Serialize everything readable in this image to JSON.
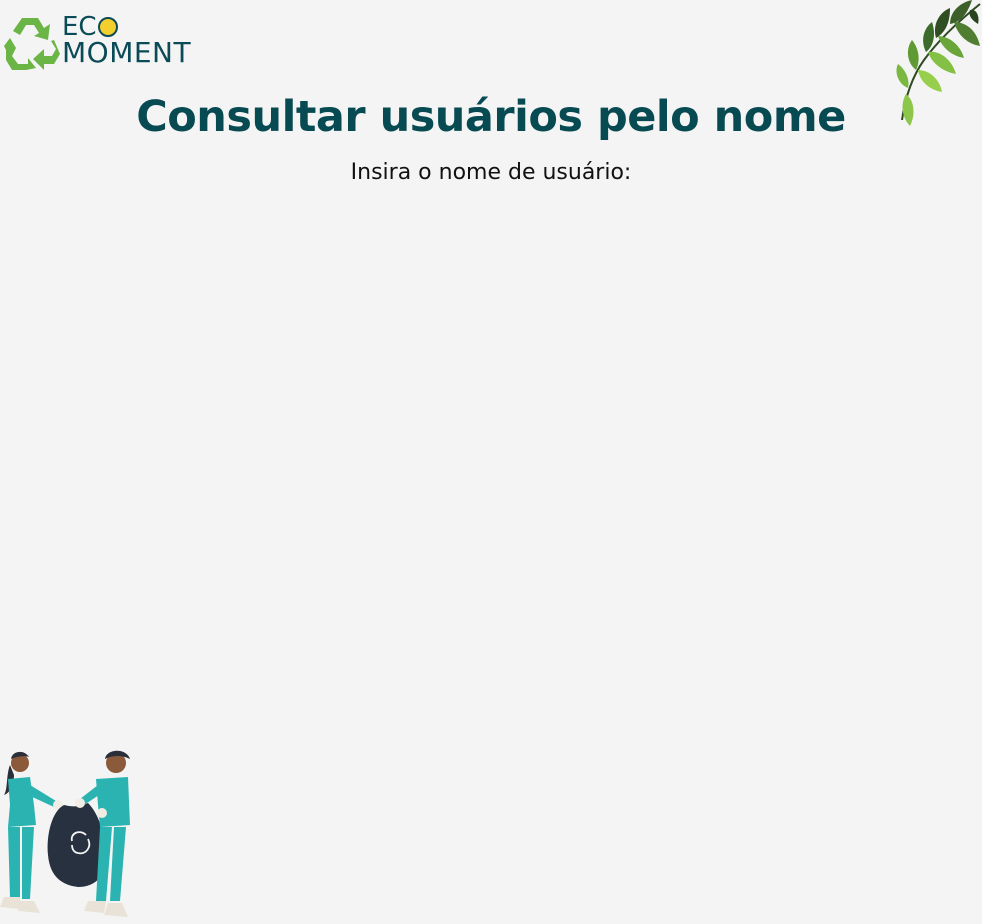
{
  "logo": {
    "line1": "EC",
    "line2": "MOMENT",
    "icons": [
      "recycle-icon",
      "lightbulb-icon"
    ]
  },
  "page": {
    "title": "Consultar usuários pelo nome",
    "prompt": "Insira o nome de usuário:"
  },
  "decorations": [
    "leaves-branch-illustration",
    "people-recycling-illustration"
  ],
  "colors": {
    "background": "#f4f4f4",
    "title": "#074a52",
    "brand_green": "#6ab545",
    "bulb_yellow": "#f2cf2e",
    "scrubs_teal": "#2bb3b1",
    "bag_dark": "#27313f"
  }
}
